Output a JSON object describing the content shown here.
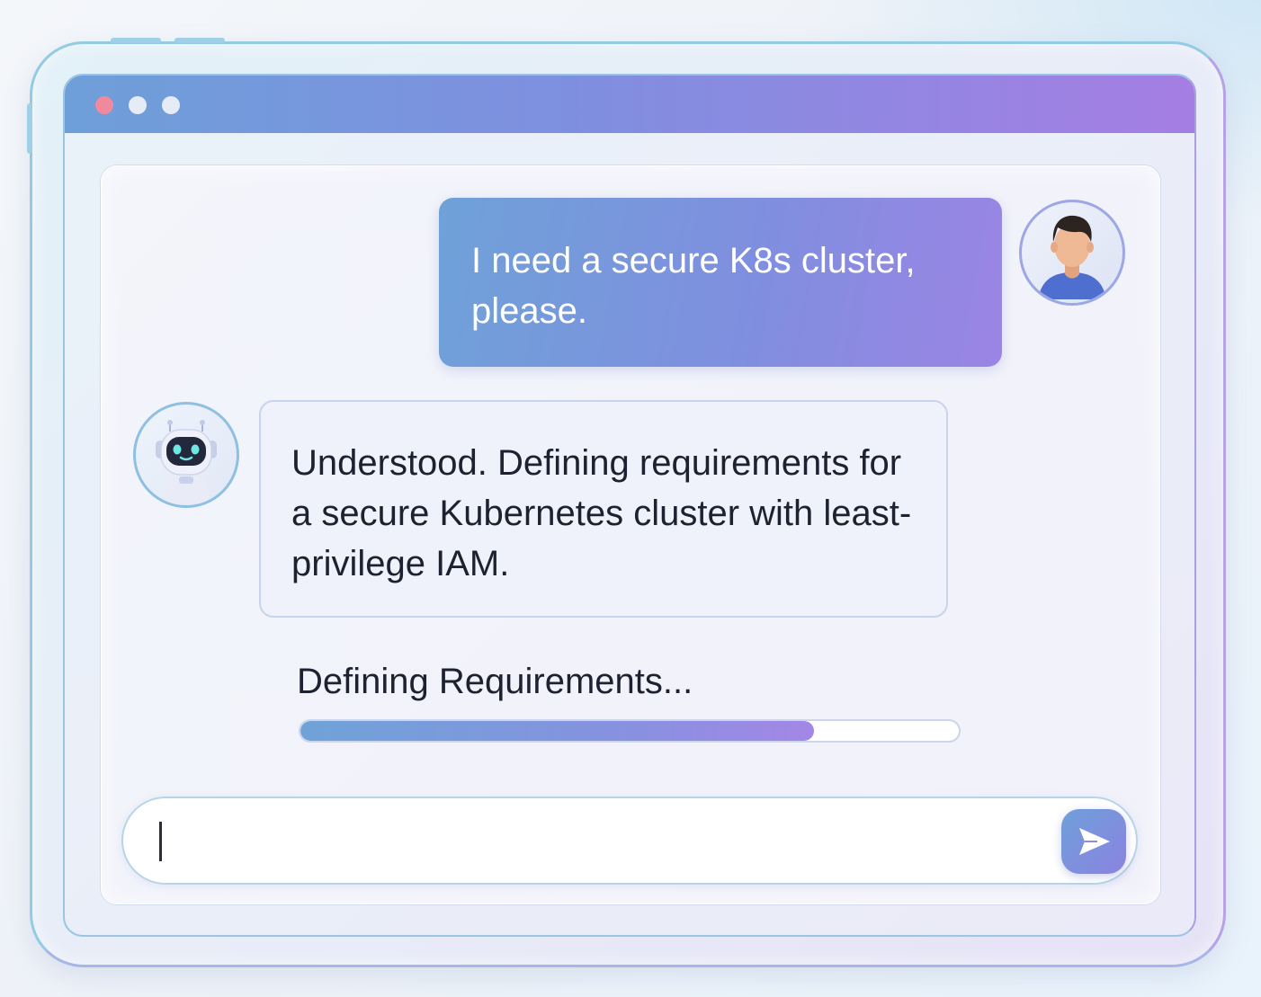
{
  "window": {
    "controls": [
      {
        "name": "close",
        "color": "#ee8a9c"
      },
      {
        "name": "minimize",
        "color": "#e6ecf6"
      },
      {
        "name": "maximize",
        "color": "#e6ecf6"
      }
    ]
  },
  "chat": {
    "user_message": "I need a secure K8s cluster, please.",
    "bot_message": "Understood. Defining requirements for a secure Kubernetes cluster with least-privilege IAM."
  },
  "progress": {
    "label": "Defining Requirements...",
    "fraction": 0.78
  },
  "composer": {
    "value": "",
    "send_icon": "send-icon"
  },
  "colors": {
    "accent_start": "#6fa1d8",
    "accent_end": "#a387e6"
  }
}
